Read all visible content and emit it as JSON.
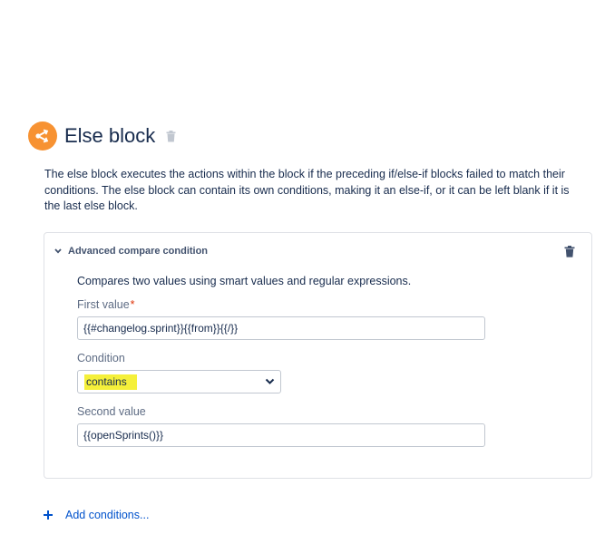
{
  "block": {
    "title": "Else block",
    "description": "The else block executes the actions within the block if the preceding if/else-if blocks failed to match their conditions. The else block can contain its own conditions, making it an else-if, or it can be left blank if it is the last else block."
  },
  "condition_card": {
    "title": "Advanced compare condition",
    "description": "Compares two values using smart values and regular expressions.",
    "first_value": {
      "label": "First value",
      "required_marker": "*",
      "value": "{{#changelog.sprint}}{{from}}{{/}}"
    },
    "condition": {
      "label": "Condition",
      "selected": "contains",
      "highlighted": true
    },
    "second_value": {
      "label": "Second value",
      "value": "{{openSprints()}}"
    }
  },
  "add_conditions": {
    "label": "Add conditions..."
  },
  "colors": {
    "accent_orange": "#f79232",
    "link_blue": "#0052cc",
    "highlight_yellow": "#f5f03a",
    "required_red": "#de350b"
  },
  "icons": [
    "branch-icon",
    "trash-icon",
    "chevron-down-icon",
    "plus-icon"
  ]
}
